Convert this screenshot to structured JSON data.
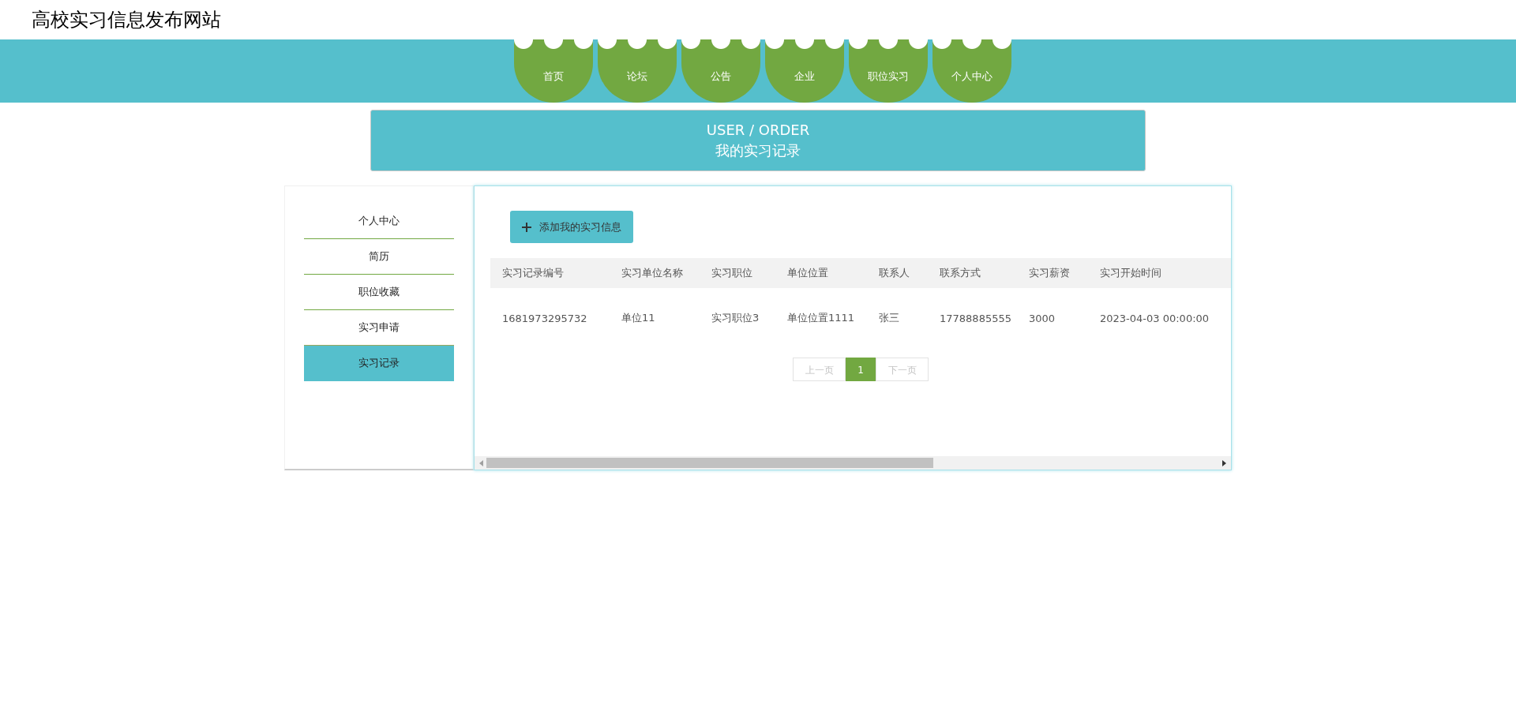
{
  "site_title": "高校实习信息发布网站",
  "nav": [
    {
      "label": "首页",
      "selected": false
    },
    {
      "label": "论坛",
      "selected": false
    },
    {
      "label": "公告",
      "selected": false
    },
    {
      "label": "企业",
      "selected": false
    },
    {
      "label": "职位实习",
      "selected": false
    },
    {
      "label": "个人中心",
      "selected": false
    }
  ],
  "banner": {
    "title": "USER / ORDER",
    "subtitle": "我的实习记录"
  },
  "sidebar": {
    "items": [
      {
        "label": "个人中心",
        "selected": false
      },
      {
        "label": "简历",
        "selected": false
      },
      {
        "label": "职位收藏",
        "selected": false
      },
      {
        "label": "实习申请",
        "selected": false
      },
      {
        "label": "实习记录",
        "selected": true
      }
    ]
  },
  "add_button": "添加我的实习信息",
  "table": {
    "columns": [
      "实习记录编号",
      "实习单位名称",
      "实习职位",
      "单位位置",
      "联系人",
      "联系方式",
      "实习薪资",
      "实习开始时间"
    ],
    "rows": [
      [
        "1681973295732",
        "单位11",
        "实习职位3",
        "单位位置1111",
        "张三",
        "17788885555",
        "3000",
        "2023-04-03 00:00:00"
      ]
    ]
  },
  "pagination": {
    "prev": "上一页",
    "pages": [
      {
        "label": "1",
        "selected": true
      }
    ],
    "next": "下一页"
  }
}
